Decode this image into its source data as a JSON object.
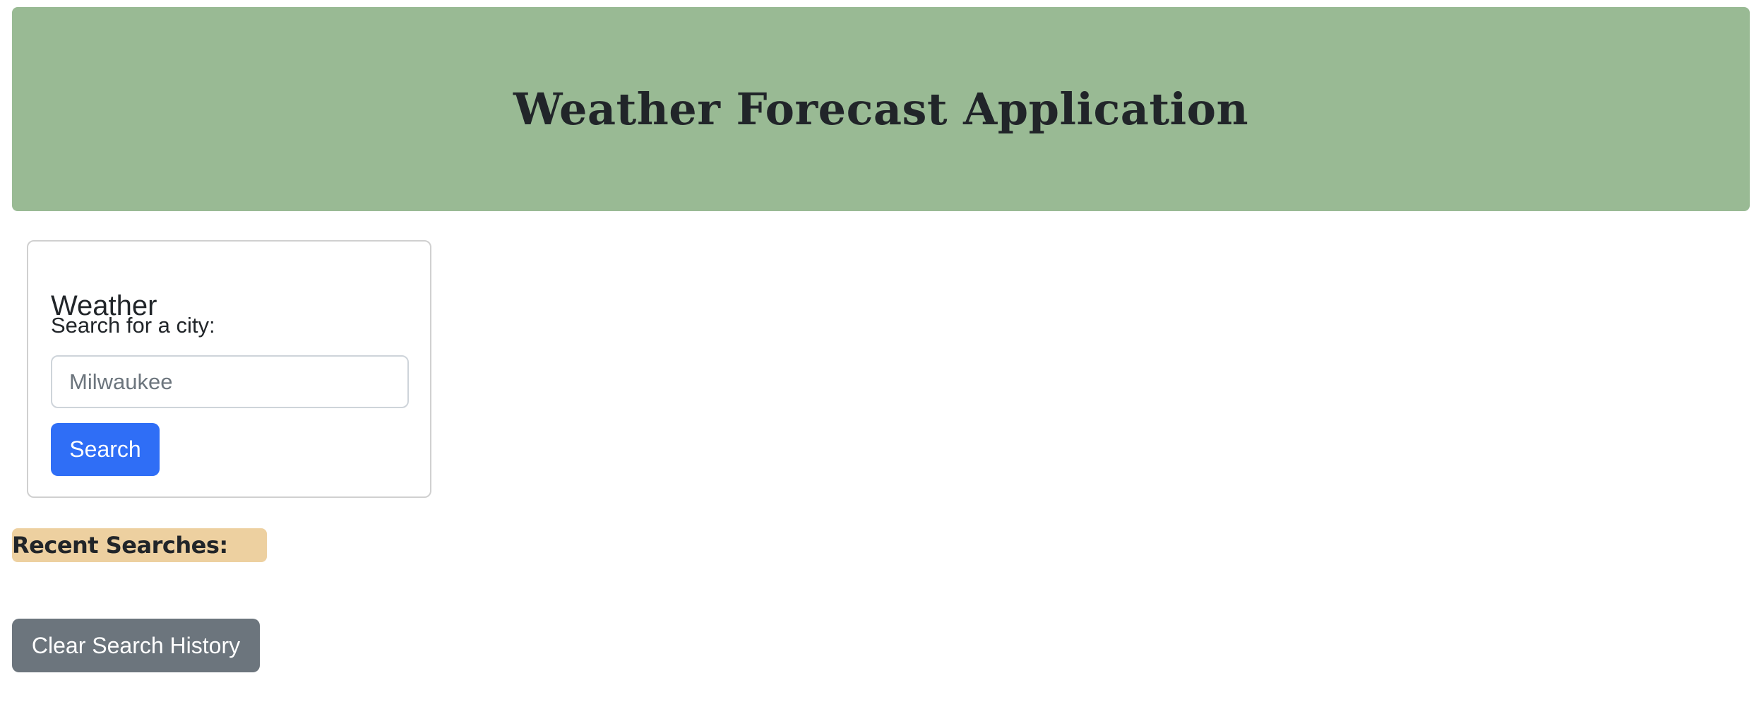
{
  "header": {
    "title": "Weather Forecast Application",
    "background_color": "#99ba94"
  },
  "weather_card": {
    "title": "Weather",
    "search_label": "Search for a city:",
    "search_input": {
      "placeholder": "Milwaukee",
      "value": ""
    },
    "search_button_label": "Search",
    "search_button_color": "#2f6ef6"
  },
  "recent_searches": {
    "label": "Recent Searches:",
    "background_color": "#edd0a0",
    "items": []
  },
  "clear_history": {
    "label": "Clear Search History",
    "color": "#6c757d"
  }
}
